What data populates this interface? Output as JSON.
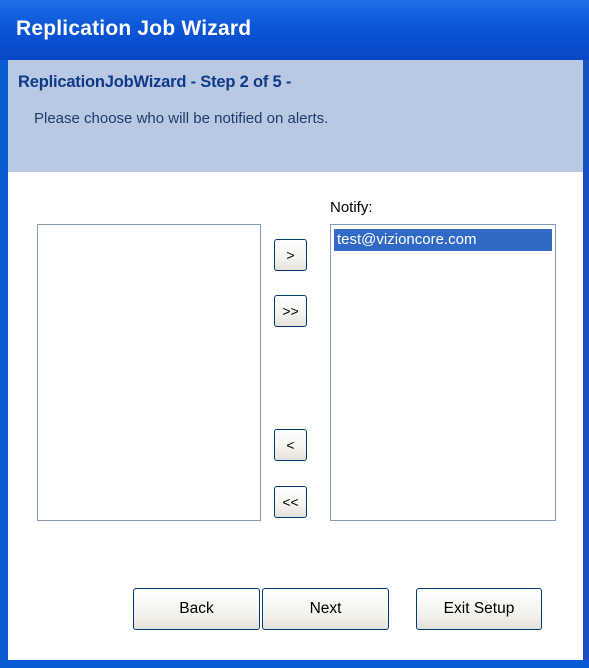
{
  "window": {
    "title": "Replication Job Wizard"
  },
  "header": {
    "step_title": "ReplicationJobWizard - Step 2 of 5 -",
    "description": "Please choose who will be notified on alerts."
  },
  "lists": {
    "available": {
      "items": []
    },
    "notify": {
      "label": "Notify:",
      "items": [
        {
          "label": "test@vizioncore.com",
          "selected": true
        }
      ]
    }
  },
  "transfer_buttons": {
    "add": ">",
    "add_all": ">>",
    "remove": "<",
    "remove_all": "<<"
  },
  "footer_buttons": {
    "back": "Back",
    "next": "Next",
    "exit": "Exit Setup"
  },
  "colors": {
    "title_bar": "#0a5ad6",
    "header_band": "#b9c9e4",
    "selection": "#3169c6",
    "header_text": "#0e3a8a"
  }
}
